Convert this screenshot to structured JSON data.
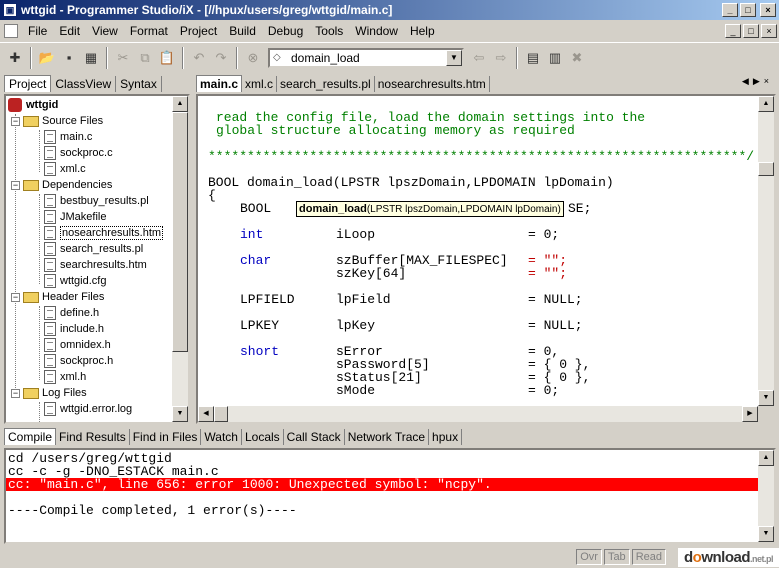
{
  "window": {
    "title": "wttgid - Programmer Studio/iX - [//hpux/users/greg/wttgid/main.c]",
    "min": "_",
    "max": "□",
    "close": "×"
  },
  "menu": [
    "File",
    "Edit",
    "View",
    "Format",
    "Project",
    "Build",
    "Debug",
    "Tools",
    "Window",
    "Help"
  ],
  "toolbar": {
    "function_combo": "domain_load"
  },
  "left_tabs": [
    "Project",
    "ClassView",
    "Syntax"
  ],
  "tree": {
    "root": "wttgid",
    "groups": [
      {
        "label": "Source Files",
        "items": [
          "main.c",
          "sockproc.c",
          "xml.c"
        ]
      },
      {
        "label": "Dependencies",
        "items": [
          "bestbuy_results.pl",
          "JMakefile",
          "nosearchresults.htm",
          "search_results.pl",
          "searchresults.htm",
          "wttgid.cfg"
        ]
      },
      {
        "label": "Header Files",
        "items": [
          "define.h",
          "include.h",
          "omnidex.h",
          "sockproc.h",
          "xml.h"
        ]
      },
      {
        "label": "Log Files",
        "items": [
          "wttgid.error.log"
        ]
      }
    ],
    "selected": "nosearchresults.htm"
  },
  "editor_tabs": [
    "main.c",
    "xml.c",
    "search_results.pl",
    "nosearchresults.htm"
  ],
  "editor": {
    "comment1": "read the config file, load the domain settings into the",
    "comment2": "global structure allocating memory as required",
    "stars": "*********************************************************************/",
    "signature": "BOOL domain_load(LPSTR lpszDomain,LPDOMAIN lpDomain)",
    "brace": "{",
    "lines": [
      {
        "type": "BOOL",
        "name": "",
        "value": "SE;"
      },
      {
        "type": "int",
        "name": "iLoop",
        "value": "= 0;"
      },
      {
        "type": "char",
        "name": "szBuffer[MAX_FILESPEC]",
        "value": "= \"\";"
      },
      {
        "type": "",
        "name": "szKey[64]",
        "value": "= \"\";"
      },
      {
        "type": "LPFIELD",
        "name": "lpField",
        "value": "= NULL;"
      },
      {
        "type": "LPKEY",
        "name": "lpKey",
        "value": "= NULL;"
      },
      {
        "type": "short",
        "name": "sError",
        "value": "= 0,"
      },
      {
        "type": "",
        "name": "sPassword[5]",
        "value": "= { 0 },"
      },
      {
        "type": "",
        "name": "sStatus[21]",
        "value": "= { 0 },"
      },
      {
        "type": "",
        "name": "sMode",
        "value": "= 0;"
      }
    ],
    "tooltip": {
      "name": "domain_load",
      "params": "(LPSTR lpszDomain,LPDOMAIN lpDomain)"
    }
  },
  "output_tabs": [
    "Compile",
    "Find Results",
    "Find in Files",
    "Watch",
    "Locals",
    "Call Stack",
    "Network Trace",
    "hpux"
  ],
  "output": [
    "cd /users/greg/wttgid",
    "cc -c -g -DNO_ESTACK main.c",
    "cc: \"main.c\", line 656: error 1000: Unexpected symbol: \"ncpy\".",
    "",
    "----Compile completed, 1 error(s)----"
  ],
  "status": {
    "ovr": "Ovr",
    "tab": "Tab",
    "read": "Read"
  },
  "watermark": {
    "text_a": "d",
    "text_o": "o",
    "text_b": "wnload",
    "tld": ".net.pl"
  },
  "colors": {
    "title_start": "#0a246a",
    "comment": "#008000",
    "keyword": "#0000c0",
    "string": "#c00000",
    "error_bg": "#ff0000"
  }
}
